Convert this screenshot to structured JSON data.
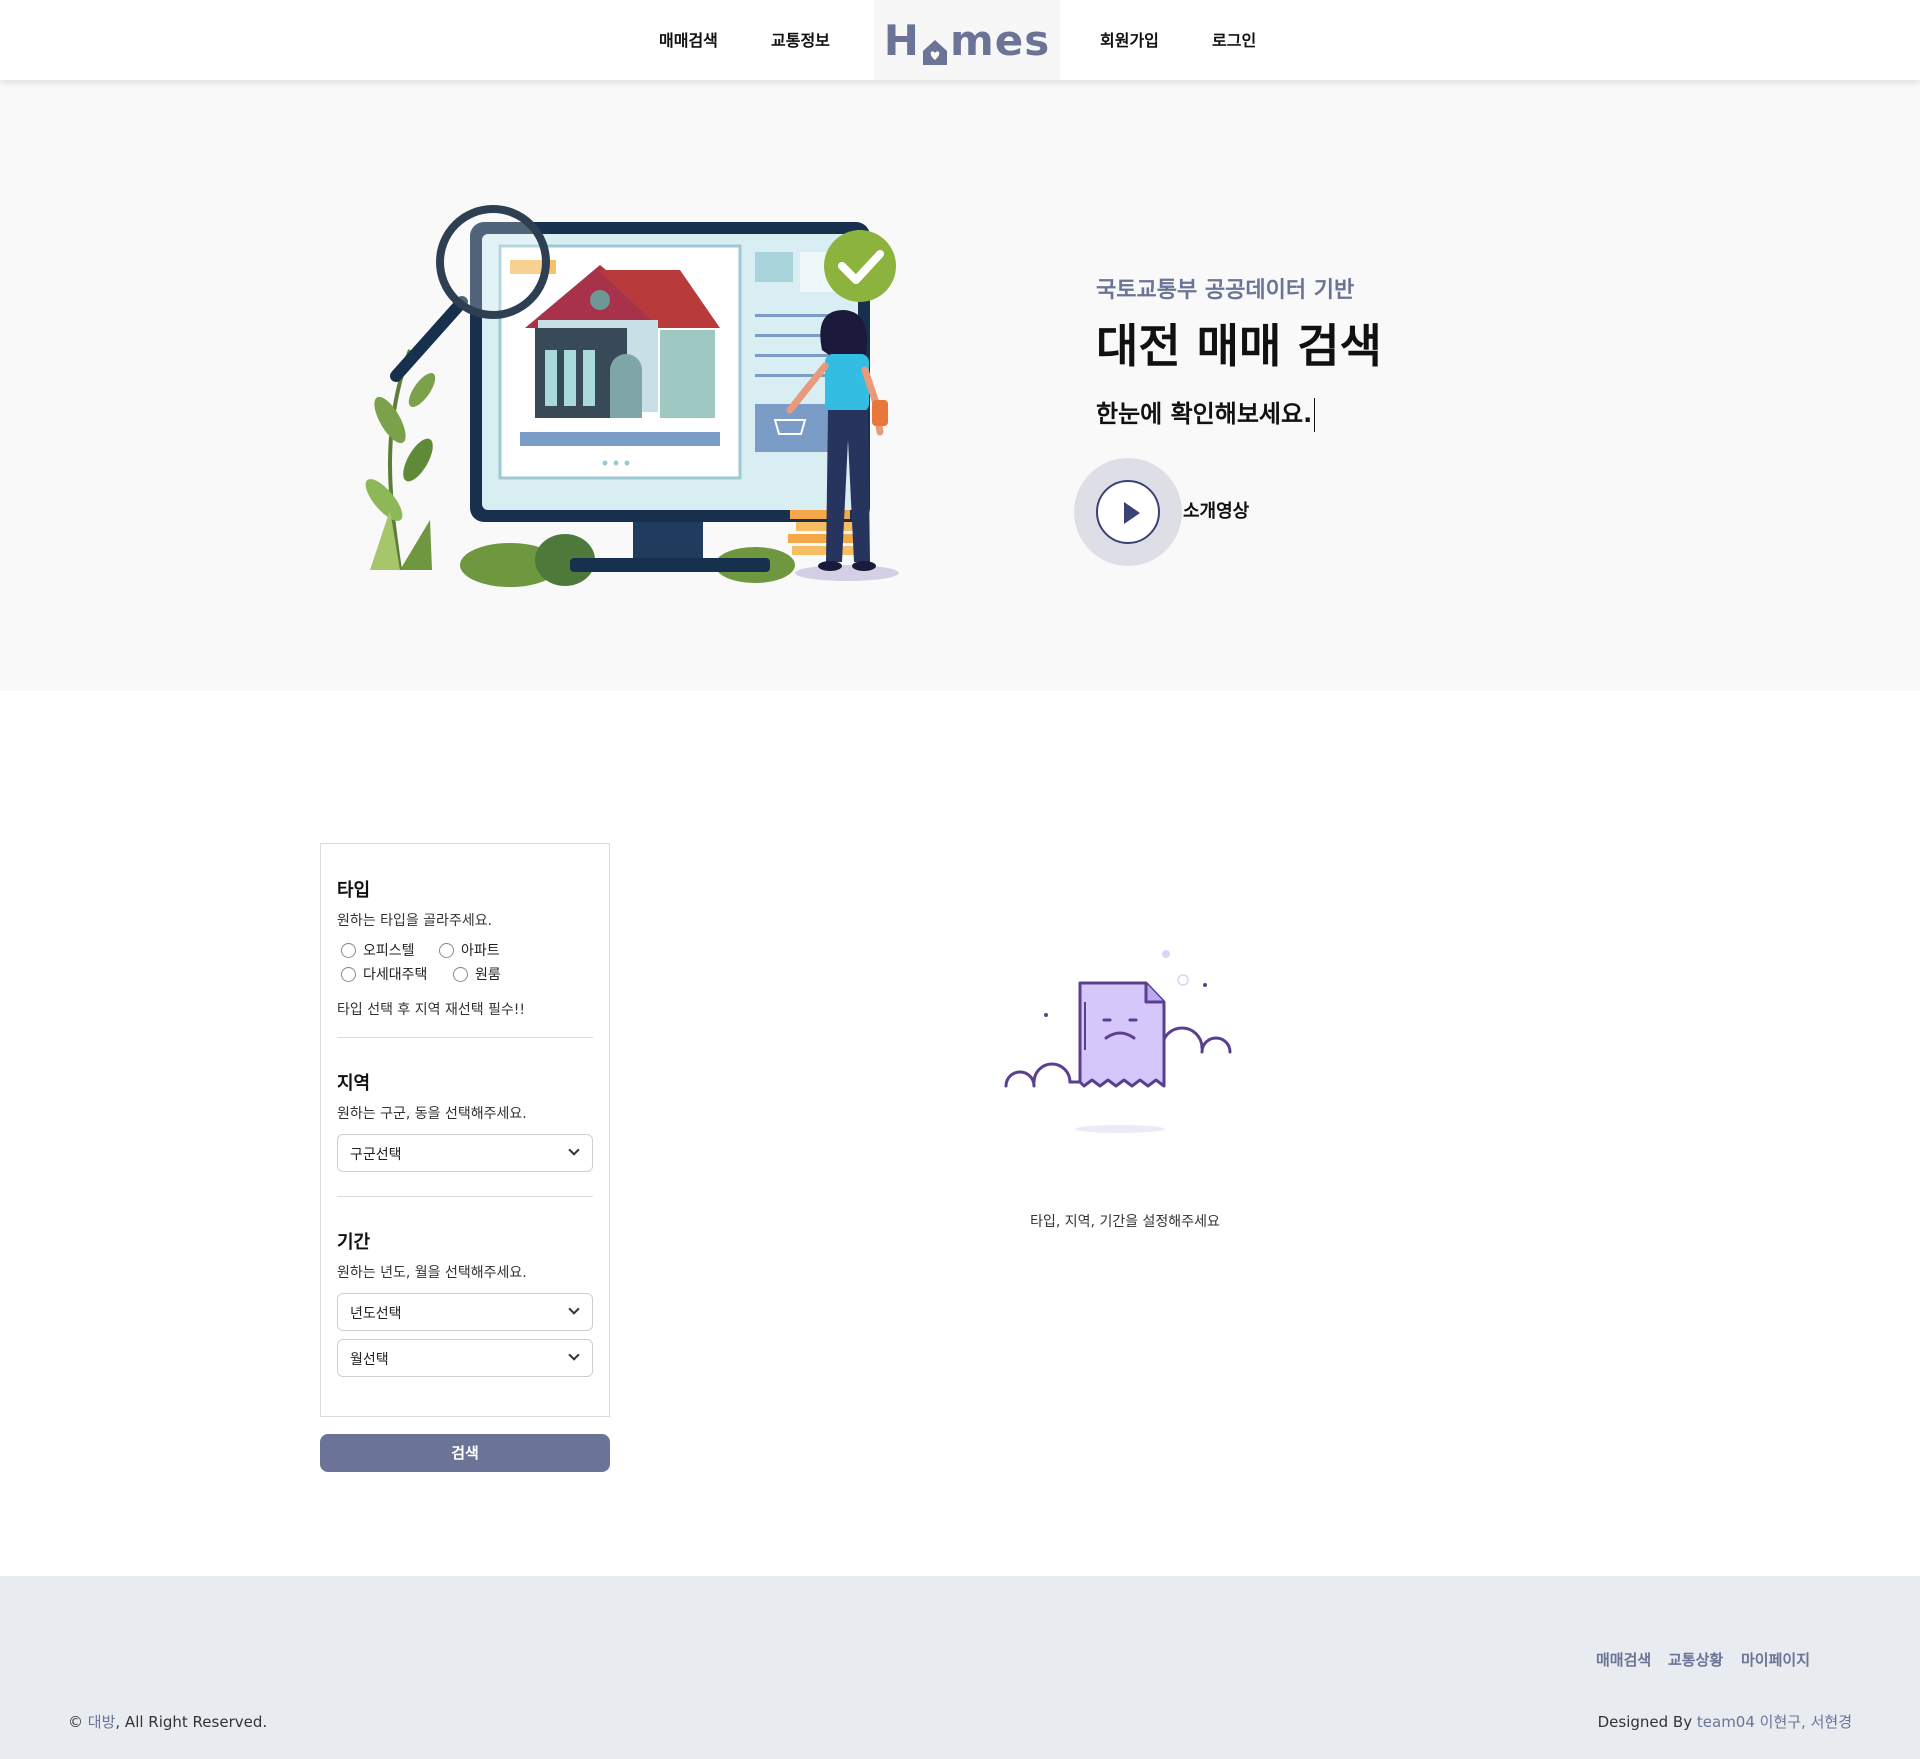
{
  "nav": {
    "left_items": [
      "매매검색",
      "교통정보"
    ],
    "logo": {
      "before": "H",
      "after": "mes"
    },
    "right_items": [
      "회원가입",
      "로그인"
    ]
  },
  "hero": {
    "subtitle": "국토교통부 공공데이터 기반",
    "title": "대전 매매 검색",
    "description": "한눈에 확인해보세요.",
    "video_label": "소개영상"
  },
  "filter": {
    "type": {
      "title": "타입",
      "description": "원하는 타입을 골라주세요.",
      "options": [
        "오피스텔",
        "아파트",
        "다세대주택",
        "원룸"
      ],
      "note": "타입 선택 후 지역 재선택 필수!!"
    },
    "region": {
      "title": "지역",
      "description": "원하는 구군, 동을 선택해주세요.",
      "select_value": "구군선택"
    },
    "period": {
      "title": "기간",
      "description": "원하는 년도, 월을 선택해주세요.",
      "year_value": "년도선택",
      "month_value": "월선택"
    },
    "search_label": "검색"
  },
  "empty_state": {
    "message": "타입, 지역, 기간을 설정해주세요"
  },
  "footer": {
    "links": [
      "매매검색",
      "교통상황",
      "마이페이지"
    ],
    "copyright_symbol": "©",
    "copyright_name": "대방",
    "copyright_rest": ", All Right Reserved.",
    "credit_prefix": "Designed By",
    "credit_team": "team04 이현구, 서현경"
  },
  "colors": {
    "accent": "#6b7497",
    "hero_bg": "#f9f9f9",
    "footer_bg": "#e8ebef"
  }
}
